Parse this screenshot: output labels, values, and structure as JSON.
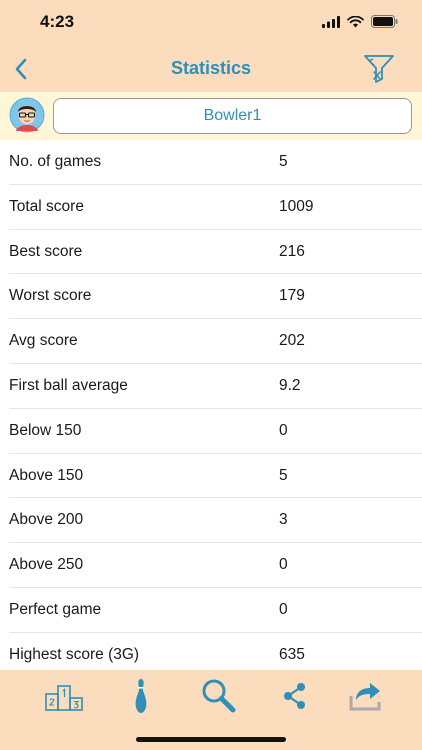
{
  "status_bar": {
    "time": "4:23"
  },
  "nav": {
    "title": "Statistics"
  },
  "bowler": {
    "name": "Bowler1"
  },
  "stats": [
    {
      "label": "No. of games",
      "value": "5"
    },
    {
      "label": "Total score",
      "value": "1009"
    },
    {
      "label": "Best score",
      "value": "216"
    },
    {
      "label": "Worst score",
      "value": "179"
    },
    {
      "label": "Avg score",
      "value": "202"
    },
    {
      "label": "First ball average",
      "value": "9.2"
    },
    {
      "label": "Below 150",
      "value": "0"
    },
    {
      "label": "Above 150",
      "value": "5"
    },
    {
      "label": "Above 200",
      "value": "3"
    },
    {
      "label": "Above 250",
      "value": "0"
    },
    {
      "label": "Perfect game",
      "value": "0"
    },
    {
      "label": "Highest score (3G)",
      "value": "635"
    }
  ],
  "tab_bar": {
    "items": [
      "podium-icon",
      "bowling-pin-icon",
      "search-icon",
      "share-icon",
      "export-icon"
    ]
  },
  "colors": {
    "header_bg": "#fbdcbc",
    "bowler_bar_bg": "#fff7d8",
    "accent": "#2f8fb8"
  }
}
